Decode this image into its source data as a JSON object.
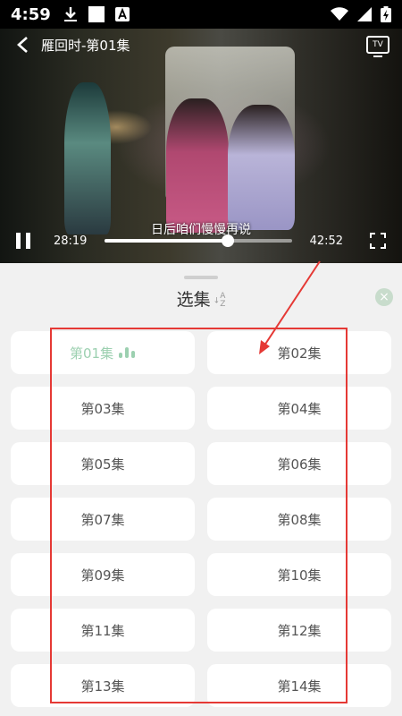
{
  "status": {
    "time": "4:59"
  },
  "player": {
    "title": "雁回时-第01集",
    "tv_label": "TV",
    "subtitle": "日后咱们慢慢再说",
    "current_time": "28:19",
    "total_time": "42:52",
    "progress": 0.66
  },
  "panel": {
    "title": "选集",
    "sort_label_top": "A",
    "sort_label_bottom": "Z",
    "episodes": [
      {
        "label": "第01集",
        "playing": true
      },
      {
        "label": "第02集"
      },
      {
        "label": "第03集"
      },
      {
        "label": "第04集"
      },
      {
        "label": "第05集"
      },
      {
        "label": "第06集"
      },
      {
        "label": "第07集"
      },
      {
        "label": "第08集"
      },
      {
        "label": "第09集"
      },
      {
        "label": "第10集"
      },
      {
        "label": "第11集"
      },
      {
        "label": "第12集"
      },
      {
        "label": "第13集"
      },
      {
        "label": "第14集"
      }
    ]
  },
  "colors": {
    "accent": "#9cd0b0",
    "annotation": "#e53935"
  }
}
